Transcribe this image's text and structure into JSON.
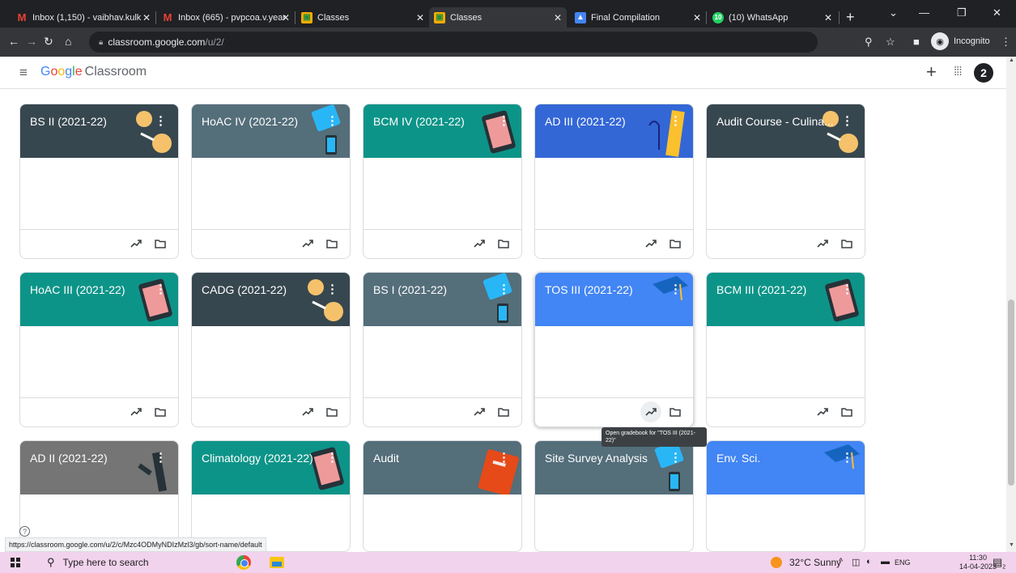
{
  "browser": {
    "tabs": [
      {
        "title": "Inbox (1,150) - vaibhav.kulk",
        "icon": "gmail-icon"
      },
      {
        "title": "Inbox (665) - pvpcoa.v.year",
        "icon": "gmail-icon"
      },
      {
        "title": "Classes",
        "icon": "classroom-icon"
      },
      {
        "title": "Classes",
        "icon": "classroom-icon"
      },
      {
        "title": "Final Compilation",
        "icon": "classroom-icon"
      },
      {
        "title": "(10) WhatsApp",
        "icon": "whatsapp-icon",
        "badge": "10"
      }
    ],
    "url_host": "classroom.google.com",
    "url_path": "/u/2/",
    "incognito_label": "Incognito"
  },
  "app": {
    "brand_google": "Google",
    "brand_product": "Classroom",
    "avatar_letter": "2"
  },
  "cards": [
    {
      "title": "BS II (2021-22)",
      "color": "#37474f"
    },
    {
      "title": "HoAC IV (2021-22)",
      "color": "#546e7a"
    },
    {
      "title": "BCM IV (2021-22)",
      "color": "#0d9488"
    },
    {
      "title": "AD III (2021-22)",
      "color": "#3367d6"
    },
    {
      "title": "Audit Course - Culina...",
      "color": "#37474f"
    },
    {
      "title": "HoAC III (2021-22)",
      "color": "#0d9488"
    },
    {
      "title": "CADG (2021-22)",
      "color": "#37474f"
    },
    {
      "title": "BS I (2021-22)",
      "color": "#546e7a"
    },
    {
      "title": "TOS III (2021-22)",
      "color": "#4285f4"
    },
    {
      "title": "BCM III (2021-22)",
      "color": "#0d9488"
    },
    {
      "title": "AD II (2021-22)",
      "color": "#757575"
    },
    {
      "title": "Climatology (2021-22)",
      "color": "#0d9488"
    },
    {
      "title": "Audit",
      "color": "#546e7a"
    },
    {
      "title": "Site Survey Analysis",
      "color": "#546e7a"
    },
    {
      "title": "Env. Sci.",
      "color": "#4285f4"
    }
  ],
  "tooltip": "Open gradebook for \"TOS III (2021-22)\"",
  "status_url": "https://classroom.google.com/u/2/c/Mzc4ODMyNDIzMzl3/gb/sort-name/default",
  "taskbar": {
    "search_placeholder": "Type here to search",
    "weather": "32°C  Sunny",
    "lang": "ENG",
    "time": "11:30",
    "date": "14-04-2023",
    "notif_count": "2"
  }
}
